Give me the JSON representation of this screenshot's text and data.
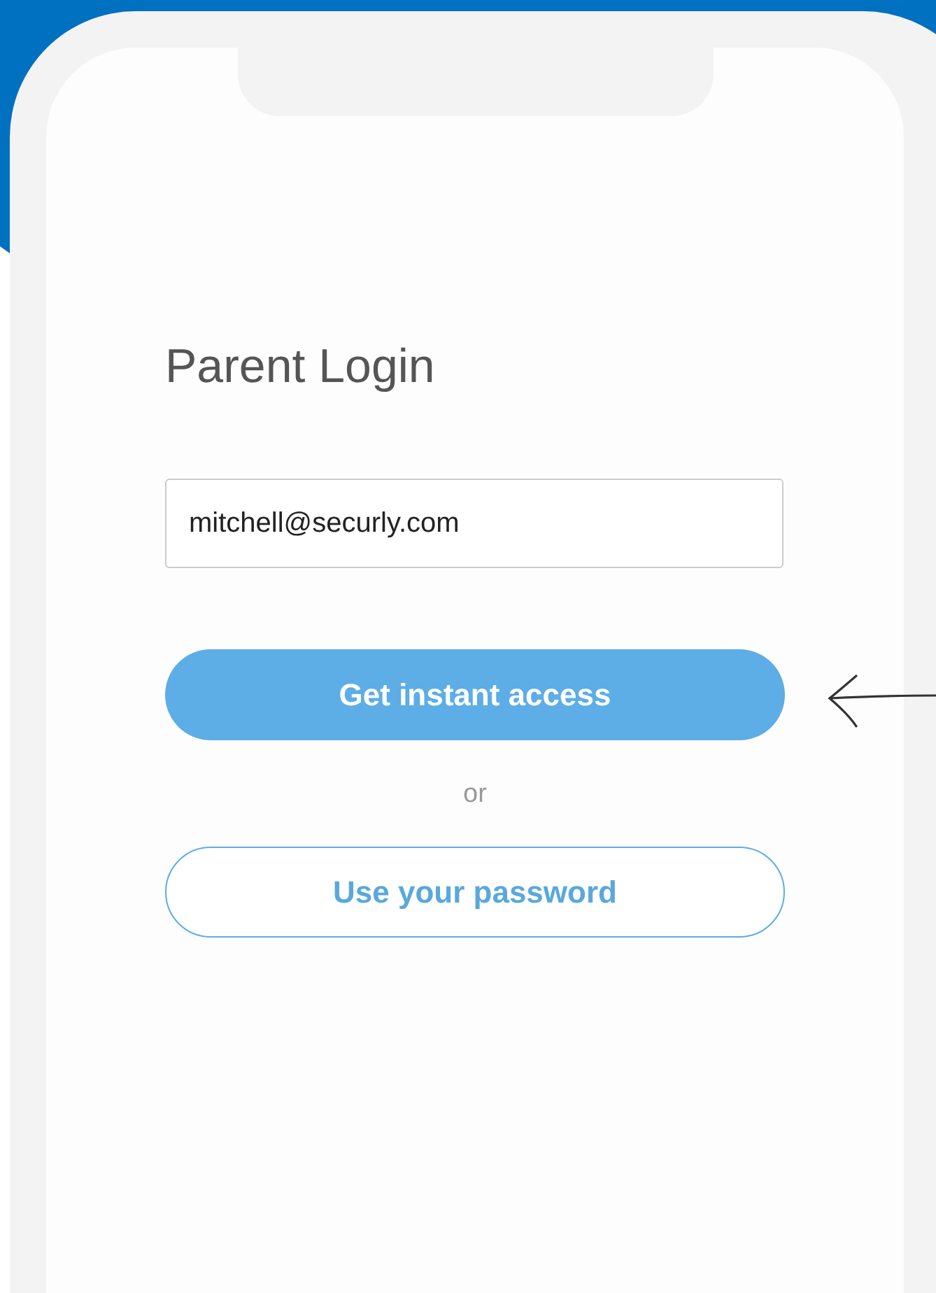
{
  "screen": {
    "title": "Parent Login",
    "email_field": {
      "value": "mitchell@securly.com"
    },
    "actions": [
      {
        "kind": "primary",
        "label": "Get instant access"
      },
      {
        "kind": "separator",
        "label": "or"
      },
      {
        "kind": "outline",
        "label": "Use your password"
      }
    ]
  }
}
